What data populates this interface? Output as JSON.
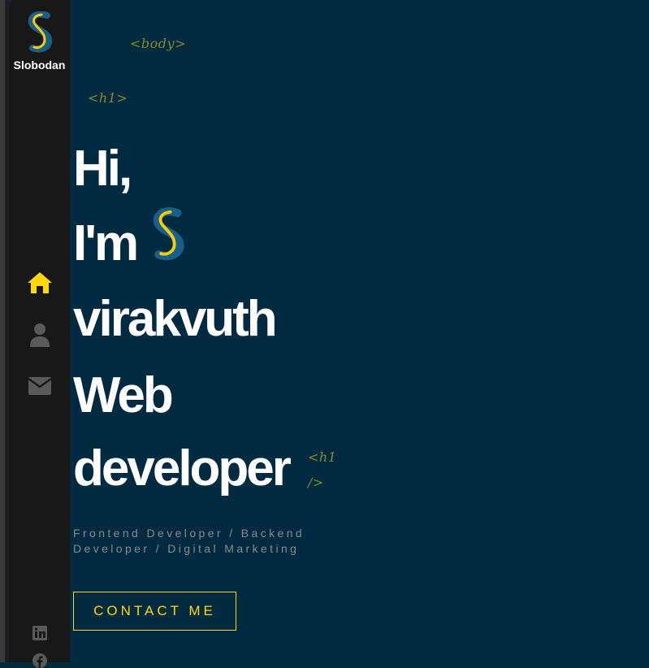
{
  "sidebar": {
    "logo_text": "Slobodan",
    "nav": [
      {
        "name": "home",
        "icon": "home-icon",
        "active": true
      },
      {
        "name": "about",
        "icon": "user-icon",
        "active": false
      },
      {
        "name": "contact",
        "icon": "envelope-icon",
        "active": false
      }
    ],
    "social": [
      {
        "name": "linkedin",
        "icon": "linkedin-icon"
      },
      {
        "name": "facebook",
        "icon": "facebook-icon"
      }
    ]
  },
  "tags": {
    "body_open": "<body>",
    "h1_open": "<h1>",
    "h1_close_a": "<h1",
    "h1_close_b": "/>"
  },
  "hero": {
    "line1": "Hi,",
    "line2": "I'm",
    "line3": "virakvuth",
    "line4": "Web",
    "line5": "developer",
    "subtitle": "Frontend Developer / Backend Developer / Digital Marketing",
    "cta_label": "CONTACT ME"
  },
  "colors": {
    "background": "#022b42",
    "sidebar": "#181818",
    "accent": "#ffd70a",
    "tag": "#8d8a25",
    "icon_inactive": "#5a5a5a",
    "logo_blue": "#1a5e8a"
  }
}
